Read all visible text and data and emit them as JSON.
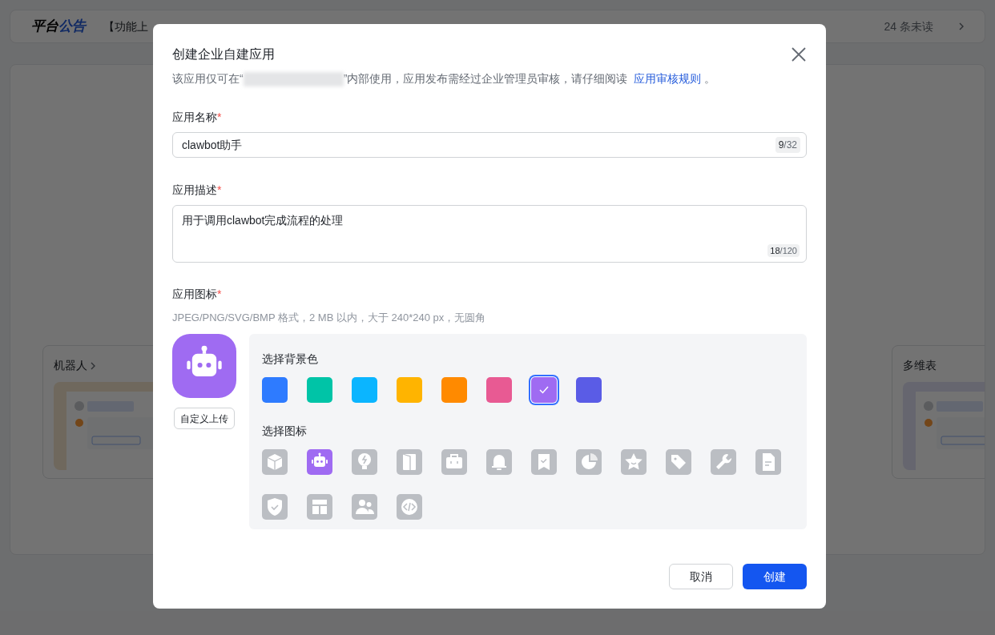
{
  "background": {
    "announcement": {
      "brand": "平台",
      "brand_highlight": "公告",
      "headline": "【功能上",
      "unread": "24 条未读"
    },
    "cards": [
      {
        "title": "机器人",
        "kind": "robot"
      },
      {
        "title": "多维表",
        "kind": "table"
      }
    ]
  },
  "dialog": {
    "title": "创建企业自建应用",
    "notice_before": "该应用仅可在“",
    "notice_after": "”内部使用，应用发布需经过企业管理员审核，请仔细阅读",
    "notice_link": "应用审核规则",
    "notice_end": "。",
    "name_field": {
      "label": "应用名称",
      "required_mark": "*",
      "value": "clawbot助手",
      "count": "9",
      "limit": "/32"
    },
    "desc_field": {
      "label": "应用描述",
      "required_mark": "*",
      "value": "用于调用clawbot完成流程的处理",
      "count": "18",
      "limit": "/120"
    },
    "icon_section": {
      "label": "应用图标",
      "required_mark": "*",
      "hint": "JPEG/PNG/SVG/BMP 格式，2 MB 以内，大于 240*240 px，无圆角",
      "upload_button": "自定义上传",
      "color_title": "选择背景色",
      "colors": [
        {
          "color": "#2e7bff",
          "selected": false
        },
        {
          "color": "#00c4a7",
          "selected": false
        },
        {
          "color": "#0bb5ff",
          "selected": false
        },
        {
          "color": "#ffb400",
          "selected": false
        },
        {
          "color": "#ff8a00",
          "selected": false
        },
        {
          "color": "#e85a93",
          "selected": false
        },
        {
          "color": "#9f6bf2",
          "selected": true
        },
        {
          "color": "#5a5ce6",
          "selected": false
        }
      ],
      "icon_title": "选择图标",
      "icons": [
        {
          "kind": "cube",
          "selected": false
        },
        {
          "kind": "robot",
          "selected": true
        },
        {
          "kind": "bulb",
          "selected": false
        },
        {
          "kind": "door",
          "selected": false
        },
        {
          "kind": "briefcase",
          "selected": false
        },
        {
          "kind": "bell",
          "selected": false
        },
        {
          "kind": "bookmark",
          "selected": false
        },
        {
          "kind": "pie",
          "selected": false
        },
        {
          "kind": "star",
          "selected": false
        },
        {
          "kind": "tag",
          "selected": false
        },
        {
          "kind": "wrench",
          "selected": false
        },
        {
          "kind": "document",
          "selected": false
        },
        {
          "kind": "shield",
          "selected": false
        },
        {
          "kind": "layout",
          "selected": false
        },
        {
          "kind": "people",
          "selected": false
        },
        {
          "kind": "code",
          "selected": false
        }
      ]
    },
    "buttons": {
      "cancel": "取消",
      "create": "创建"
    }
  }
}
